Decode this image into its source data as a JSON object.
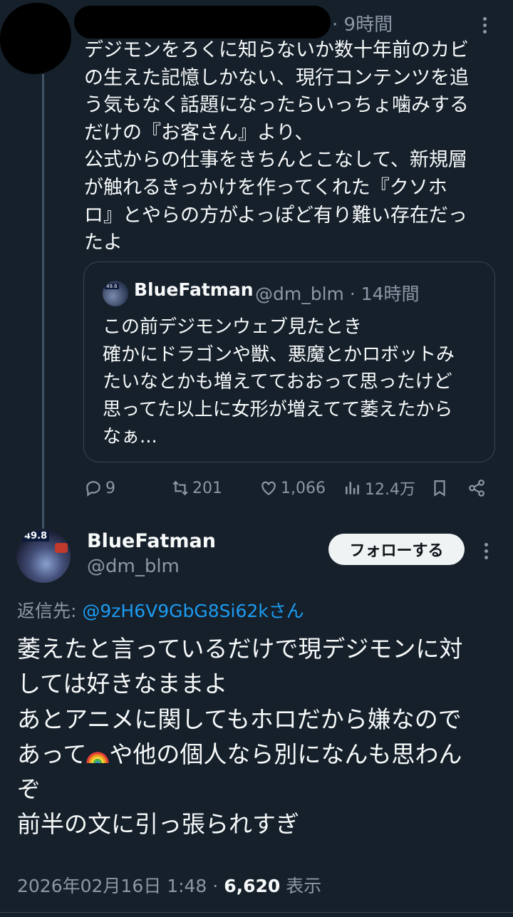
{
  "parent": {
    "time": "· 9時間",
    "text": "デジモンをろくに知らないか数十年前のカビ\nの生えた記憶しかない、現行コンテンツを追\nう気もなく話題になったらいっちょ噛みする\nだけの『お客さん』より、\n公式からの仕事をきちんとこなして、新規層\nが触れるきっかけを作ってくれた『クソホ\nロ』とやらの方がよっぽど有り難い存在だっ\nたよ",
    "quote": {
      "avatar_badge": "49.6",
      "name": "BlueFatman",
      "handle": "@dm_blm · 14時間",
      "text": "この前デジモンウェブ見たとき\n確かにドラゴンや獣、悪魔とかロボットみ\nたいなとかも増えてておおって思ったけど\n思ってた以上に女形が増えてて萎えたから\nなぁ..."
    },
    "actions": {
      "replies": "9",
      "reposts": "201",
      "likes": "1,066",
      "views": "12.4万"
    }
  },
  "reply": {
    "avatar_badge": "49.8",
    "name": "BlueFatman",
    "handle": "@dm_blm",
    "follow_label": "フォローする",
    "reply_to_prefix": "返信先: ",
    "reply_to_handle": "@9zH6V9GbG8Si62kさん",
    "text_before_emoji": "萎えたと言っているだけで現デジモンに対\nしては好きなままよ\nあとアニメに関してもホロだから嫌なので\nあって",
    "emoji": "rainbow",
    "text_after_emoji": "や他の個人なら別になんも思わん\nぞ\n前半の文に引っ張られすぎ",
    "timestamp": "2026年02月16日 1:48 · ",
    "view_count": "6,620",
    "view_label": " 表示"
  },
  "colors": {
    "background": "#15202b",
    "text": "#f7f9f9",
    "muted": "#8b98a5",
    "link": "#1d9bf0",
    "border": "#38444d"
  }
}
